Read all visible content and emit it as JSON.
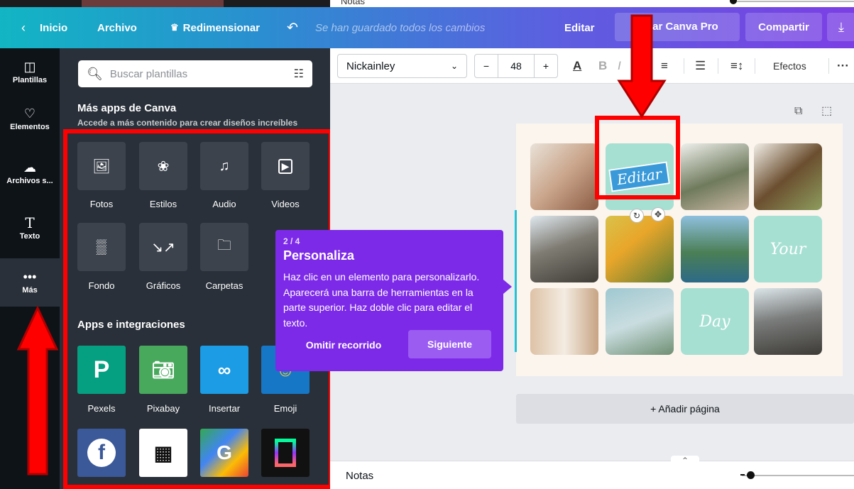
{
  "top_strip": {
    "notes_label": "Notas"
  },
  "header": {
    "back_label": "Inicio",
    "file_label": "Archivo",
    "resize_label": "Redimensionar",
    "saved_status": "Se han guardado todos los cambios",
    "edit_label": "Editar",
    "pro_label": "bar Canva Pro",
    "share_label": "Compartir"
  },
  "rail": {
    "items": [
      {
        "label": "Plantillas",
        "icon": "layout-icon"
      },
      {
        "label": "Elementos",
        "icon": "shapes-icon"
      },
      {
        "label": "Archivos s...",
        "icon": "cloud-upload-icon"
      },
      {
        "label": "Texto",
        "icon": "text-icon"
      },
      {
        "label": "Más",
        "icon": "more-dots-icon"
      }
    ]
  },
  "panel": {
    "search_placeholder": "Buscar plantillas",
    "more_apps_title": "Más apps de Canva",
    "more_apps_subtitle": "Accede a más contenido para crear diseños increíbles",
    "apps": [
      {
        "label": "Fotos",
        "icon": "image-icon"
      },
      {
        "label": "Estilos",
        "icon": "palette-icon"
      },
      {
        "label": "Audio",
        "icon": "music-note-icon"
      },
      {
        "label": "Videos",
        "icon": "play-icon"
      },
      {
        "label": "Fondo",
        "icon": "background-pattern-icon"
      },
      {
        "label": "Gráficos",
        "icon": "chart-line-icon"
      },
      {
        "label": "Carpetas",
        "icon": "folder-icon"
      }
    ],
    "integrations_title": "Apps e integraciones",
    "integrations": [
      {
        "label": "Pexels",
        "color": "#05a081"
      },
      {
        "label": "Pixabay",
        "color": "#48a95d"
      },
      {
        "label": "Insertar",
        "color": "#1b9ce5"
      },
      {
        "label": "Emoji",
        "color": "#1577c6"
      }
    ]
  },
  "toolbar": {
    "font_name": "Nickainley",
    "font_size": "48",
    "minus": "−",
    "plus": "+",
    "effects_label": "Efectos",
    "more": "···"
  },
  "canvas": {
    "tiles": [
      "Editar",
      "Your",
      "Day"
    ],
    "add_page_label": "+ Añadir página"
  },
  "notes_bar": {
    "label": "Notas"
  },
  "tour": {
    "step": "2 / 4",
    "title": "Personaliza",
    "body": "Haz clic en un elemento para personalizarlo. Aparecerá una barra de herramientas en la parte superior. Haz doble clic para editar el texto.",
    "skip_label": "Omitir recorrido",
    "next_label": "Siguiente"
  },
  "colors": {
    "accent_purple": "#7d2ae8",
    "annotation_red": "#ff0000",
    "panel_dark": "#293039",
    "mint_tile": "#a6e0d2"
  }
}
